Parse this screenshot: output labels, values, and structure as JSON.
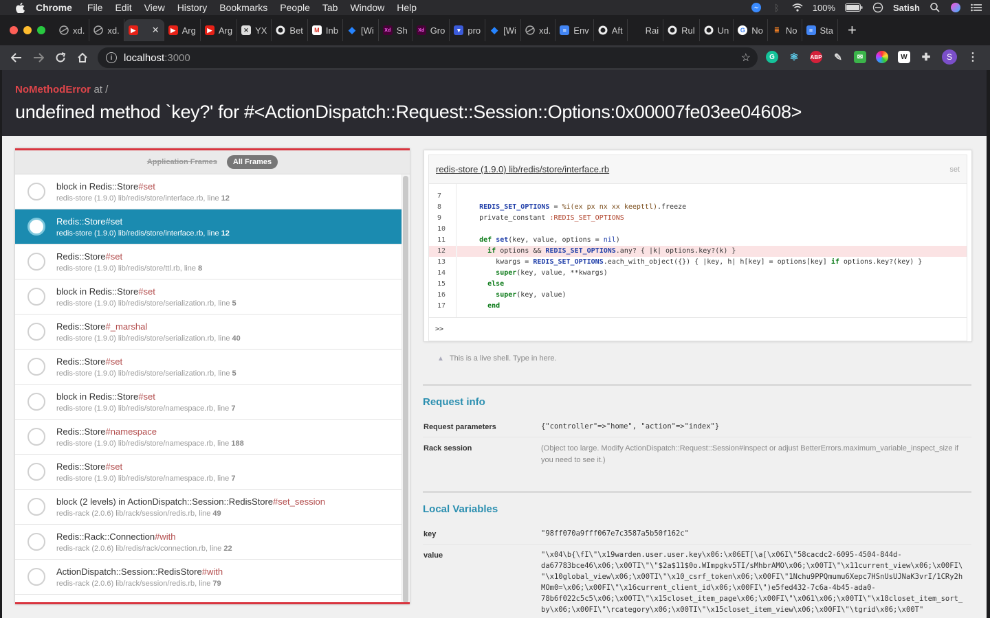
{
  "menubar": {
    "app": "Chrome",
    "items": [
      "File",
      "Edit",
      "View",
      "History",
      "Bookmarks",
      "People",
      "Tab",
      "Window",
      "Help"
    ],
    "battery": "100%",
    "user": "Satish"
  },
  "tabs": [
    {
      "label": "xd.",
      "icon": "globe-icon",
      "color": "#555"
    },
    {
      "label": "xd.",
      "icon": "globe-icon",
      "color": "#555"
    },
    {
      "label": "",
      "icon": "youtube-icon",
      "color": "#e62117",
      "active": true
    },
    {
      "label": "Arg",
      "icon": "youtube-icon",
      "color": "#e62117"
    },
    {
      "label": "Arg",
      "icon": "youtube-icon",
      "color": "#e62117"
    },
    {
      "label": "YX",
      "icon": "tools-icon",
      "color": "#666"
    },
    {
      "label": "Bet",
      "icon": "github-icon",
      "color": "#222"
    },
    {
      "label": "Inb",
      "icon": "gmail-icon",
      "color": "#d93025"
    },
    {
      "label": "[Wi",
      "icon": "jira-icon",
      "color": "#2684ff"
    },
    {
      "label": "Sh",
      "icon": "xd-icon",
      "color": "#ff2bc2"
    },
    {
      "label": "Gro",
      "icon": "xd-icon",
      "color": "#ff2bc2"
    },
    {
      "label": "pro",
      "icon": "shield-icon",
      "color": "#3b5bdb"
    },
    {
      "label": "[Wi",
      "icon": "jira-icon",
      "color": "#2684ff"
    },
    {
      "label": "xd.",
      "icon": "globe-icon",
      "color": "#555"
    },
    {
      "label": "Env",
      "icon": "docs-icon",
      "color": "#4285f4"
    },
    {
      "label": "Aft",
      "icon": "github-icon",
      "color": "#222"
    },
    {
      "label": "Rai",
      "icon": "blank-icon",
      "color": "#1e1e20"
    },
    {
      "label": "Rul",
      "icon": "github-icon",
      "color": "#222"
    },
    {
      "label": "Un",
      "icon": "github-icon",
      "color": "#222"
    },
    {
      "label": "No",
      "icon": "google-icon",
      "color": "#fff"
    },
    {
      "label": "No",
      "icon": "stack-icon",
      "color": "#f48024"
    },
    {
      "label": "Sta",
      "icon": "docs-icon",
      "color": "#4285f4"
    }
  ],
  "toolbar": {
    "url_host": "localhost",
    "url_port": ":3000",
    "profile_initial": "S"
  },
  "error": {
    "class_name": "NoMethodError",
    "at": "at /",
    "message": "undefined method `key?' for #<ActionDispatch::Request::Session::Options:0x00007fe03ee04608>"
  },
  "frames_panel": {
    "filter_app": "Application Frames",
    "filter_all": "All Frames",
    "frames": [
      {
        "ctx": "block in Redis::Store",
        "meth": "#set",
        "file": "redis-store (1.9.0) lib/redis/store/interface.rb, line ",
        "line": "12"
      },
      {
        "ctx": "Redis::Store",
        "meth": "#set",
        "file": "redis-store (1.9.0) lib/redis/store/interface.rb, line ",
        "line": "12"
      },
      {
        "ctx": "Redis::Store",
        "meth": "#set",
        "file": "redis-store (1.9.0) lib/redis/store/ttl.rb, line ",
        "line": "8"
      },
      {
        "ctx": "block in Redis::Store",
        "meth": "#set",
        "file": "redis-store (1.9.0) lib/redis/store/serialization.rb, line ",
        "line": "5"
      },
      {
        "ctx": "Redis::Store",
        "meth": "#_marshal",
        "file": "redis-store (1.9.0) lib/redis/store/serialization.rb, line ",
        "line": "40"
      },
      {
        "ctx": "Redis::Store",
        "meth": "#set",
        "file": "redis-store (1.9.0) lib/redis/store/serialization.rb, line ",
        "line": "5"
      },
      {
        "ctx": "block in Redis::Store",
        "meth": "#set",
        "file": "redis-store (1.9.0) lib/redis/store/namespace.rb, line ",
        "line": "7"
      },
      {
        "ctx": "Redis::Store",
        "meth": "#namespace",
        "file": "redis-store (1.9.0) lib/redis/store/namespace.rb, line ",
        "line": "188"
      },
      {
        "ctx": "Redis::Store",
        "meth": "#set",
        "file": "redis-store (1.9.0) lib/redis/store/namespace.rb, line ",
        "line": "7"
      },
      {
        "ctx": "block (2 levels) in ActionDispatch::Session::RedisStore",
        "meth": "#set_session",
        "file": "redis-rack (2.0.6) lib/rack/session/redis.rb, line ",
        "line": "49"
      },
      {
        "ctx": "Redis::Rack::Connection",
        "meth": "#with",
        "file": "redis-rack (2.0.6) lib/redis/rack/connection.rb, line ",
        "line": "22"
      },
      {
        "ctx": "ActionDispatch::Session::RedisStore",
        "meth": "#with",
        "file": "redis-rack (2.0.6) lib/rack/session/redis.rb, line ",
        "line": "79"
      }
    ]
  },
  "code": {
    "file": "redis-store (1.9.0) lib/redis/store/interface.rb",
    "method": "set",
    "line_numbers": [
      "7",
      "8",
      "9",
      "10",
      "11",
      "12",
      "13",
      "14",
      "15",
      "16",
      "17"
    ],
    "highlight_line": "12",
    "prompt": ">>"
  },
  "live_hint": "This is a live shell. Type in here.",
  "request_info": {
    "title": "Request info",
    "params_label": "Request parameters",
    "params_value": "{\"controller\"=>\"home\", \"action\"=>\"index\"}",
    "session_label": "Rack session",
    "session_value": "(Object too large. Modify ActionDispatch::Request::Session#inspect or adjust BetterErrors.maximum_variable_inspect_size if you need to see it.)"
  },
  "local_variables": {
    "title": "Local Variables",
    "key_label": "key",
    "key_value": "\"98ff070a9fff067e7c3587a5b50f162c\"",
    "value_label": "value",
    "value_value": "\"\\x04\\b{\\fI\\\"\\x19warden.user.user.key\\x06:\\x06ET[\\a[\\x06I\\\"58cacdc2-6095-4504-844d-\nda67783bce46\\x06;\\x00TI\\\"\\\"$2a$11$0o.WImpgkv5TI/sMhbrAMO\\x06;\\x00TI\\\"\\x11current_view\\x06;\\x00FI\\\n\"\\x10global_view\\x06;\\x00TI\\\"\\x10_csrf_token\\x06;\\x00FI\\\"1Nchu9PPQmumu6Xepc7HSnUsUJNaK3vrI/1CRy2h\nMOm0=\\x06;\\x00FI\\\"\\x16current_client_id\\x06;\\x00FI\\\")e5fed432-7c6a-4b45-ada0-\n78b6f022c5c5\\x06;\\x00TI\\\"\\x15closet_item_page\\x06;\\x00FI\\\"\\x061\\x06;\\x00TI\\\"\\x18closet_item_sort_\nby\\x06;\\x00FI\\\"\\rcategory\\x06;\\x00TI\\\"\\x15closet_item_view\\x06;\\x00FI\\\"\\tgrid\\x06;\\x00T\""
  }
}
